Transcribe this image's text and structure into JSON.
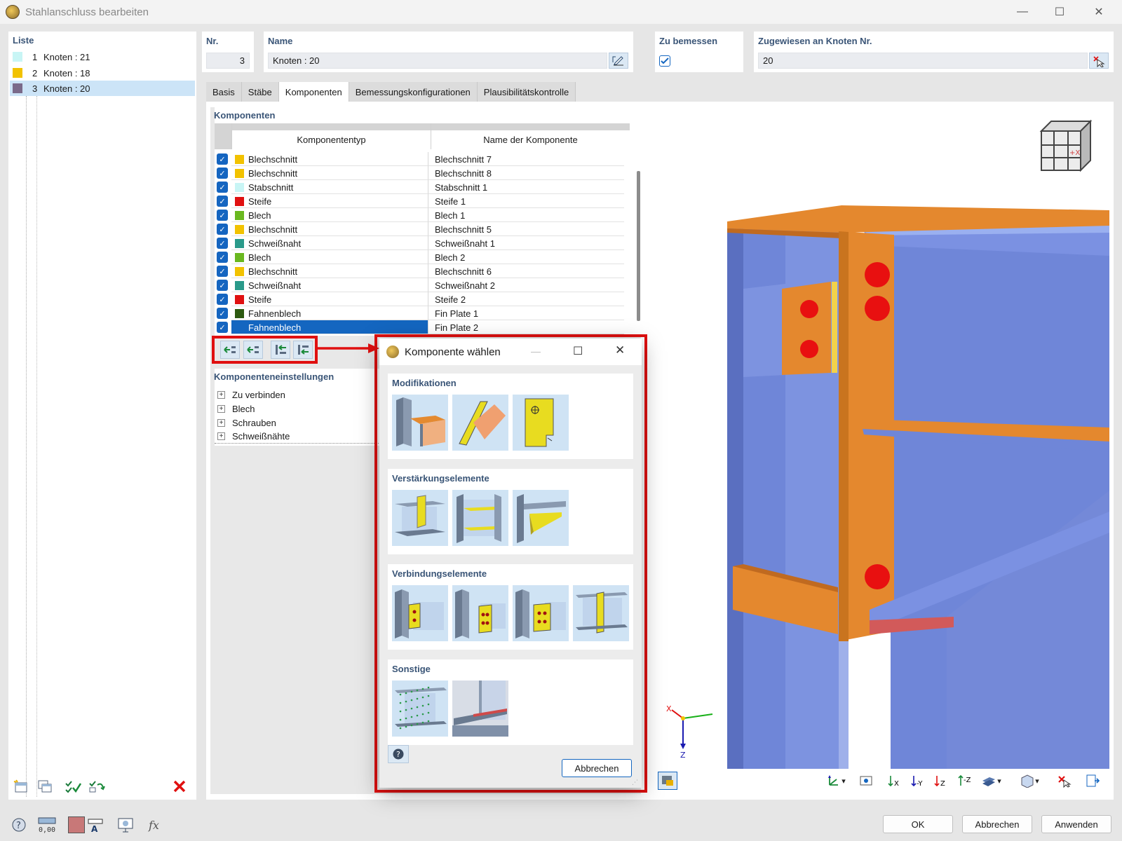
{
  "window": {
    "title": "Stahlanschluss bearbeiten"
  },
  "list": {
    "title": "Liste",
    "items": [
      {
        "num": "1",
        "label": "Knoten : 21",
        "color": "#c8f5f5"
      },
      {
        "num": "2",
        "label": "Knoten : 18",
        "color": "#f2c200"
      },
      {
        "num": "3",
        "label": "Knoten : 20",
        "color": "#7a6a8a"
      }
    ]
  },
  "header": {
    "nr_label": "Nr.",
    "nr_value": "3",
    "name_label": "Name",
    "name_value": "Knoten : 20",
    "zu_bemessen_label": "Zu bemessen",
    "zugewiesen_label": "Zugewiesen an Knoten Nr.",
    "zugewiesen_value": "20"
  },
  "tabs": [
    "Basis",
    "Stäbe",
    "Komponenten",
    "Bemessungskonfigurationen",
    "Plausibilitätskontrolle"
  ],
  "components": {
    "title": "Komponenten",
    "col_type": "Komponententyp",
    "col_name": "Name der Komponente",
    "rows": [
      {
        "type": "Blechschnitt",
        "name": "Blechschnitt 7",
        "color": "#f2c200"
      },
      {
        "type": "Blechschnitt",
        "name": "Blechschnitt 8",
        "color": "#f2c200"
      },
      {
        "type": "Stabschnitt",
        "name": "Stabschnitt 1",
        "color": "#c8f5f5"
      },
      {
        "type": "Steife",
        "name": "Steife 1",
        "color": "#e01010"
      },
      {
        "type": "Blech",
        "name": "Blech 1",
        "color": "#6ab820"
      },
      {
        "type": "Blechschnitt",
        "name": "Blechschnitt 5",
        "color": "#f2c200"
      },
      {
        "type": "Schweißnaht",
        "name": "Schweißnaht 1",
        "color": "#2a9a8a"
      },
      {
        "type": "Blech",
        "name": "Blech 2",
        "color": "#6ab820"
      },
      {
        "type": "Blechschnitt",
        "name": "Blechschnitt 6",
        "color": "#f2c200"
      },
      {
        "type": "Schweißnaht",
        "name": "Schweißnaht 2",
        "color": "#2a9a8a"
      },
      {
        "type": "Steife",
        "name": "Steife 2",
        "color": "#e01010"
      },
      {
        "type": "Fahnenblech",
        "name": "Fin Plate 1",
        "color": "#2d5a10"
      },
      {
        "type": "Fahnenblech",
        "name": "Fin Plate 2",
        "color": "#2d5a10"
      }
    ]
  },
  "settings": {
    "title": "Komponenteneinstellungen",
    "items": [
      "Zu verbinden",
      "Blech",
      "Schrauben",
      "Schweißnähte"
    ]
  },
  "dialog": {
    "title": "Komponente wählen",
    "sections": [
      "Modifikationen",
      "Verstärkungselemente",
      "Verbindungselemente",
      "Sonstige"
    ],
    "cancel": "Abbrechen"
  },
  "axes": {
    "x": "X",
    "z": "Z"
  },
  "viewcube_label": "+X",
  "footer": {
    "ok": "OK",
    "cancel": "Abbrechen",
    "apply": "Anwenden",
    "zero_label": "0,00"
  }
}
